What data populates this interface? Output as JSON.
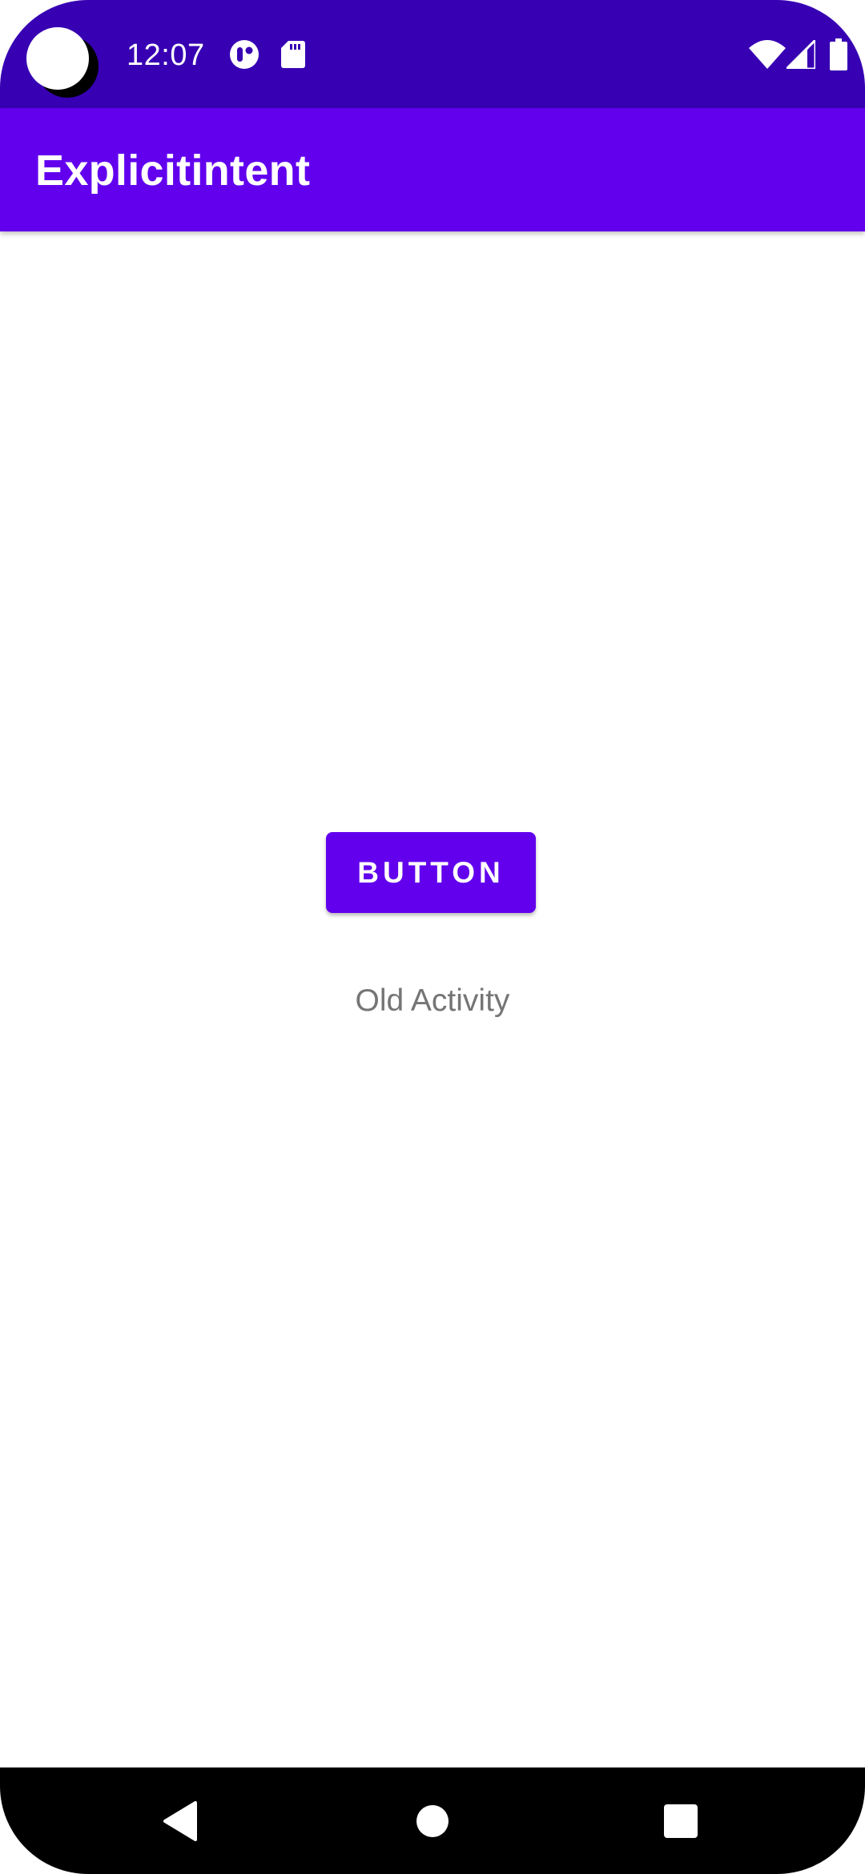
{
  "status_bar": {
    "time": "12:07",
    "background": "#3700b3",
    "icons_left": [
      "camera-cutout",
      "notification-app-icon",
      "sd-card-icon"
    ],
    "icons_right": [
      "wifi-icon",
      "cell-signal-icon",
      "battery-icon"
    ]
  },
  "app_bar": {
    "title": "Explicitintent",
    "background": "#6200ee"
  },
  "main": {
    "button_label": "BUTTON",
    "button_color": "#6200ee",
    "activity_text": "Old Activity"
  },
  "nav_bar": {
    "buttons": [
      "back-icon",
      "home-icon",
      "recents-icon"
    ]
  }
}
